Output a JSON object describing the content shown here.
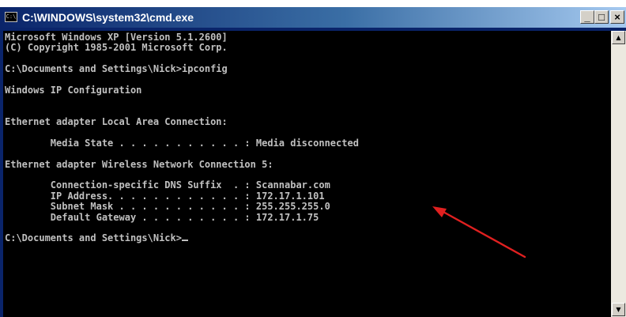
{
  "window": {
    "title": "C:\\WINDOWS\\system32\\cmd.exe",
    "icon": "cmd-icon",
    "icon_text": "C:\\",
    "buttons": {
      "minimize": "_",
      "maximize": "□",
      "close": "×"
    }
  },
  "console": {
    "lines": [
      "Microsoft Windows XP [Version 5.1.2600]",
      "(C) Copyright 1985-2001 Microsoft Corp.",
      "",
      "C:\\Documents and Settings\\Nick>ipconfig",
      "",
      "Windows IP Configuration",
      "",
      "",
      "Ethernet adapter Local Area Connection:",
      "",
      "        Media State . . . . . . . . . . . : Media disconnected",
      "",
      "Ethernet adapter Wireless Network Connection 5:",
      "",
      "        Connection-specific DNS Suffix  . : Scannabar.com",
      "        IP Address. . . . . . . . . . . . : 172.17.1.101",
      "        Subnet Mask . . . . . . . . . . . : 255.255.255.0",
      "        Default Gateway . . . . . . . . . : 172.17.1.75",
      "",
      "C:\\Documents and Settings\\Nick>"
    ]
  },
  "scrollbar": {
    "up_arrow": "▲",
    "down_arrow": "▼"
  },
  "annotation": {
    "color": "#e02020",
    "points_to": "ip-address-line"
  }
}
